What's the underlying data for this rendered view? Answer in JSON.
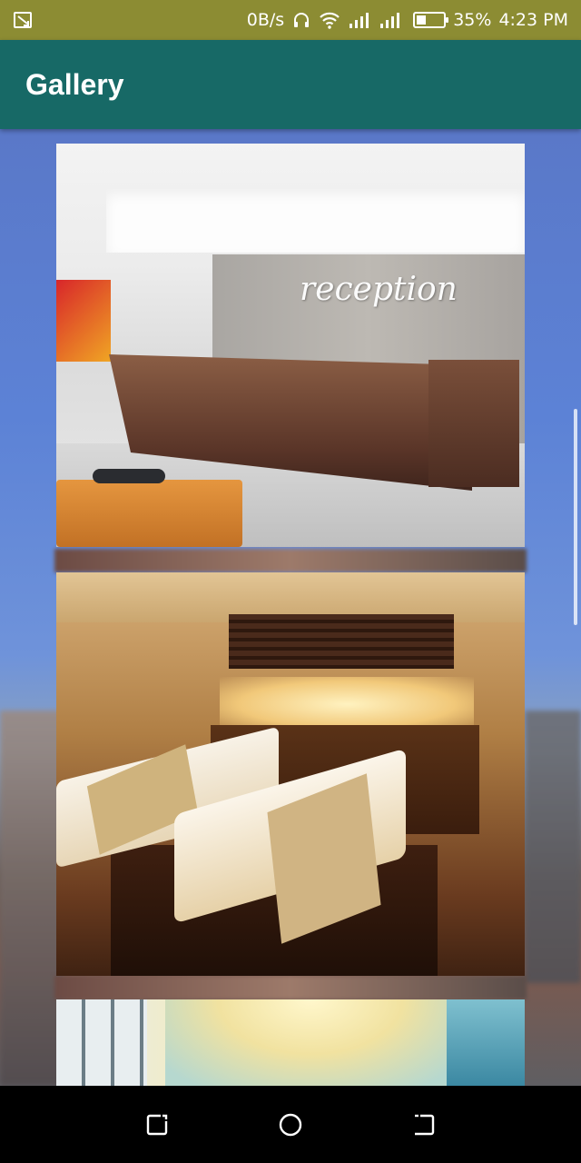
{
  "status_bar": {
    "data_rate": "0B/s",
    "battery_percent": "35%",
    "battery_level": 0.35,
    "time": "4:23 PM",
    "icons": [
      "screencast-icon",
      "headphones-icon",
      "wifi-icon",
      "signal-icon",
      "signal-icon",
      "battery-icon"
    ]
  },
  "app_bar": {
    "title": "Gallery"
  },
  "gallery": {
    "images": [
      {
        "name": "reception",
        "overlay_text": "reception"
      },
      {
        "name": "spa-room",
        "overlay_text": ""
      },
      {
        "name": "lobby",
        "overlay_text": ""
      }
    ]
  },
  "nav_bar": {
    "buttons": [
      "recent-apps-icon",
      "home-icon",
      "back-icon"
    ]
  },
  "colors": {
    "status_bar": "#8c8c33",
    "app_bar": "#176966",
    "nav_bar": "#000000"
  }
}
